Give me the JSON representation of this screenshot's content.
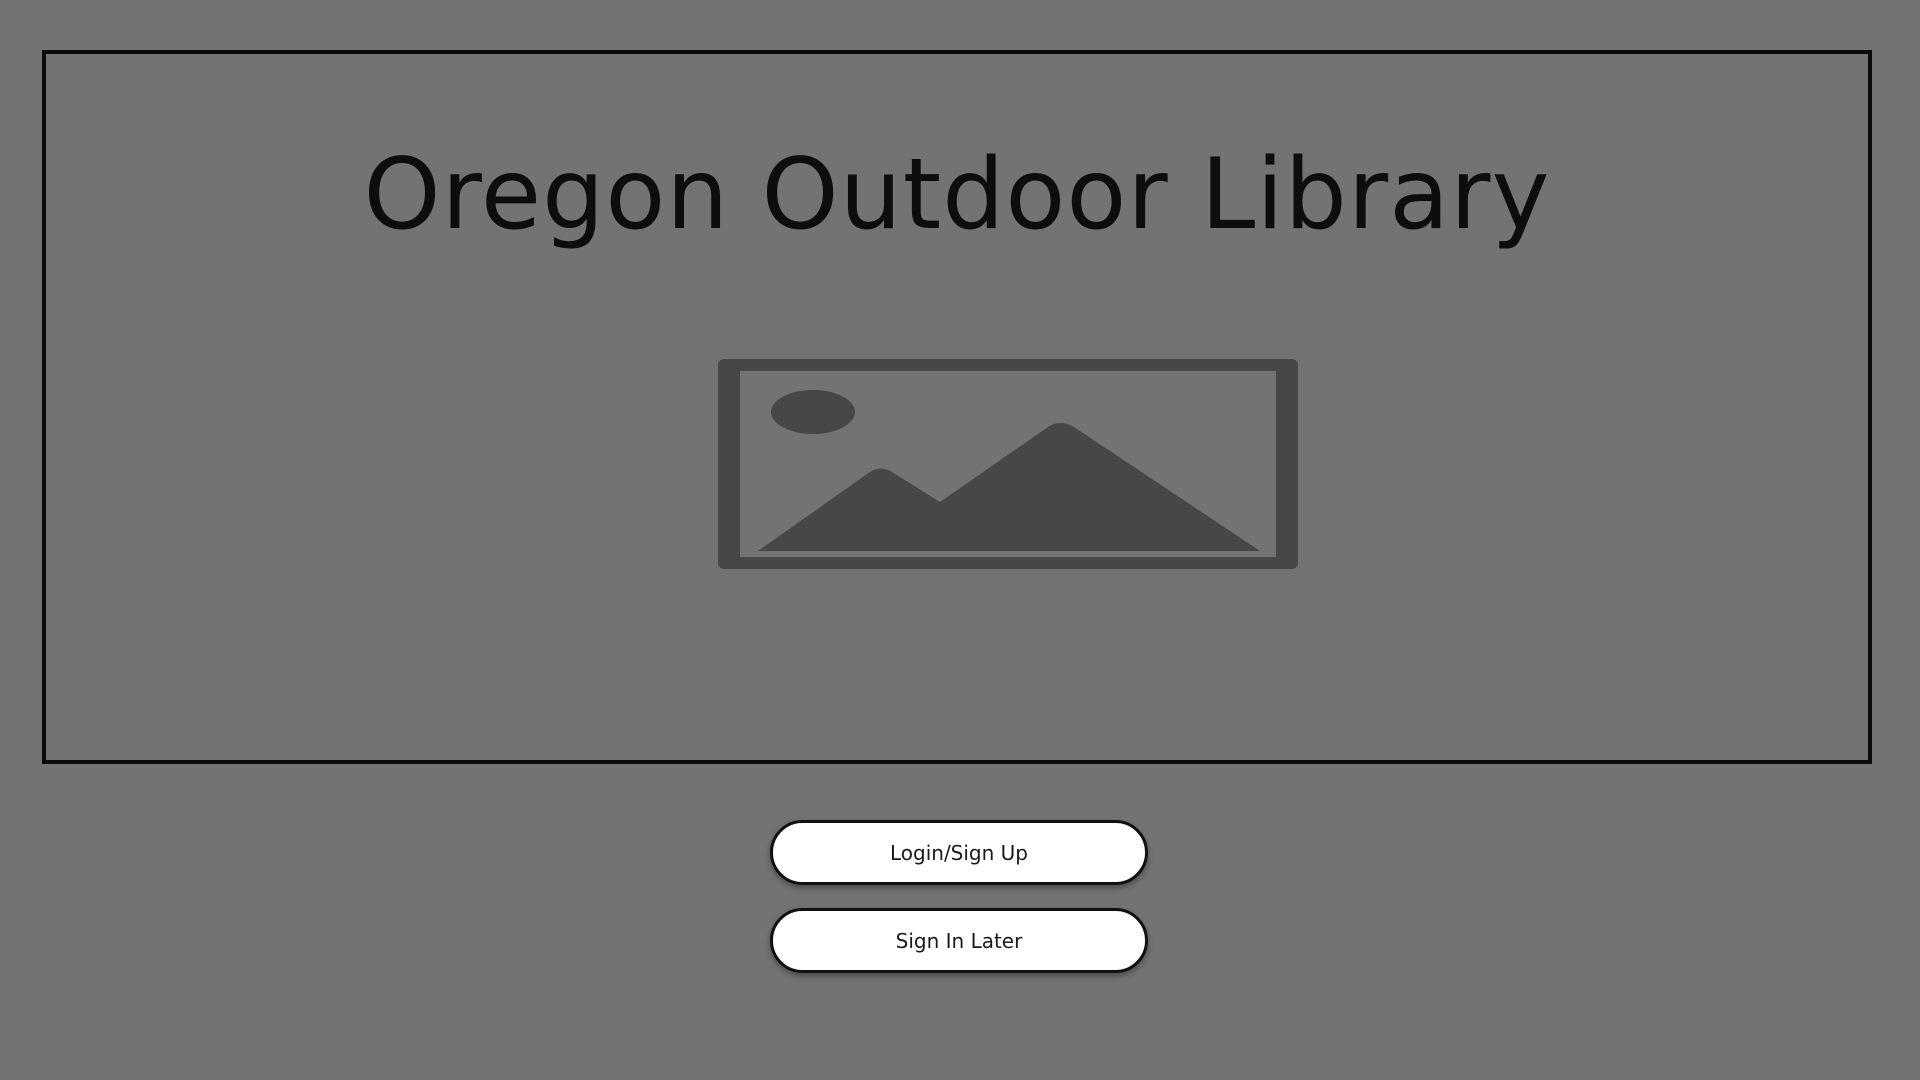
{
  "page": {
    "title": "Oregon Outdoor Library",
    "background_color": "#737373"
  },
  "hero": {
    "image_icon": "image-placeholder-icon"
  },
  "actions": {
    "login_label": "Login/Sign Up",
    "later_label": "Sign In Later"
  }
}
